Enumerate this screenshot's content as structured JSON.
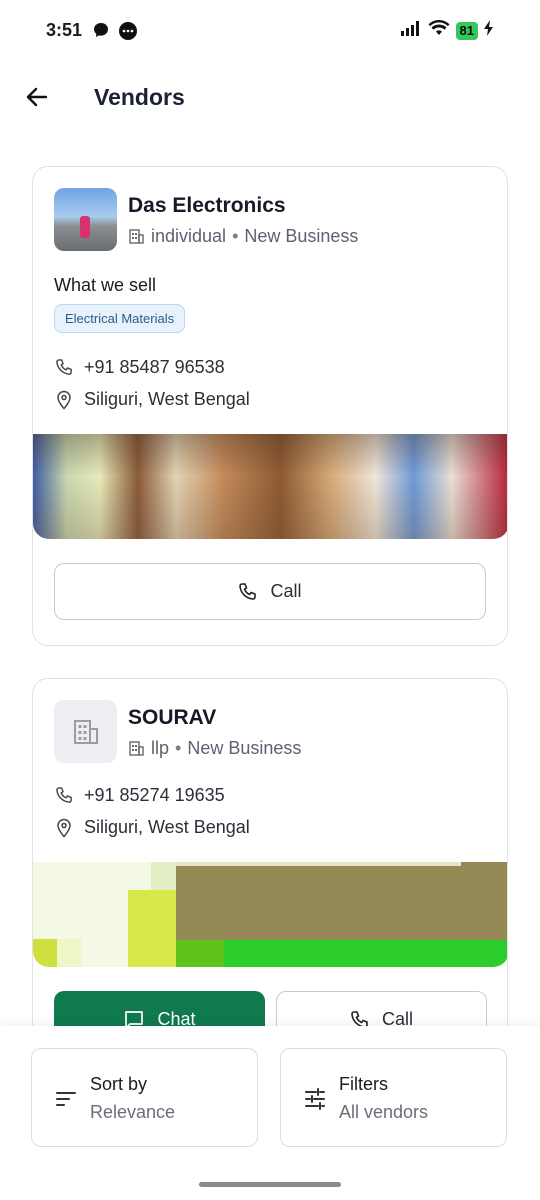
{
  "status_bar": {
    "time": "3:51",
    "battery": "81"
  },
  "header": {
    "title": "Vendors"
  },
  "vendors": [
    {
      "name": "Das Electronics",
      "type": "individual",
      "stage": "New Business",
      "what_we_sell_label": "What we sell",
      "categories": [
        "Electrical Materials"
      ],
      "phone": "+91 85487 96538",
      "location": "Siliguri, West Bengal",
      "call_label": "Call"
    },
    {
      "name": "SOURAV",
      "type": "llp",
      "stage": "New Business",
      "phone": "+91 85274 19635",
      "location": "Siliguri, West Bengal",
      "chat_label": "Chat",
      "call_label": "Call"
    }
  ],
  "meta_separator": "•",
  "bottom_bar": {
    "sort_label": "Sort by",
    "sort_value": "Relevance",
    "filter_label": "Filters",
    "filter_value": "All vendors"
  },
  "colors": {
    "primary": "#0e7a4e",
    "tag_bg": "#e8f2fc",
    "battery": "#34c759"
  }
}
